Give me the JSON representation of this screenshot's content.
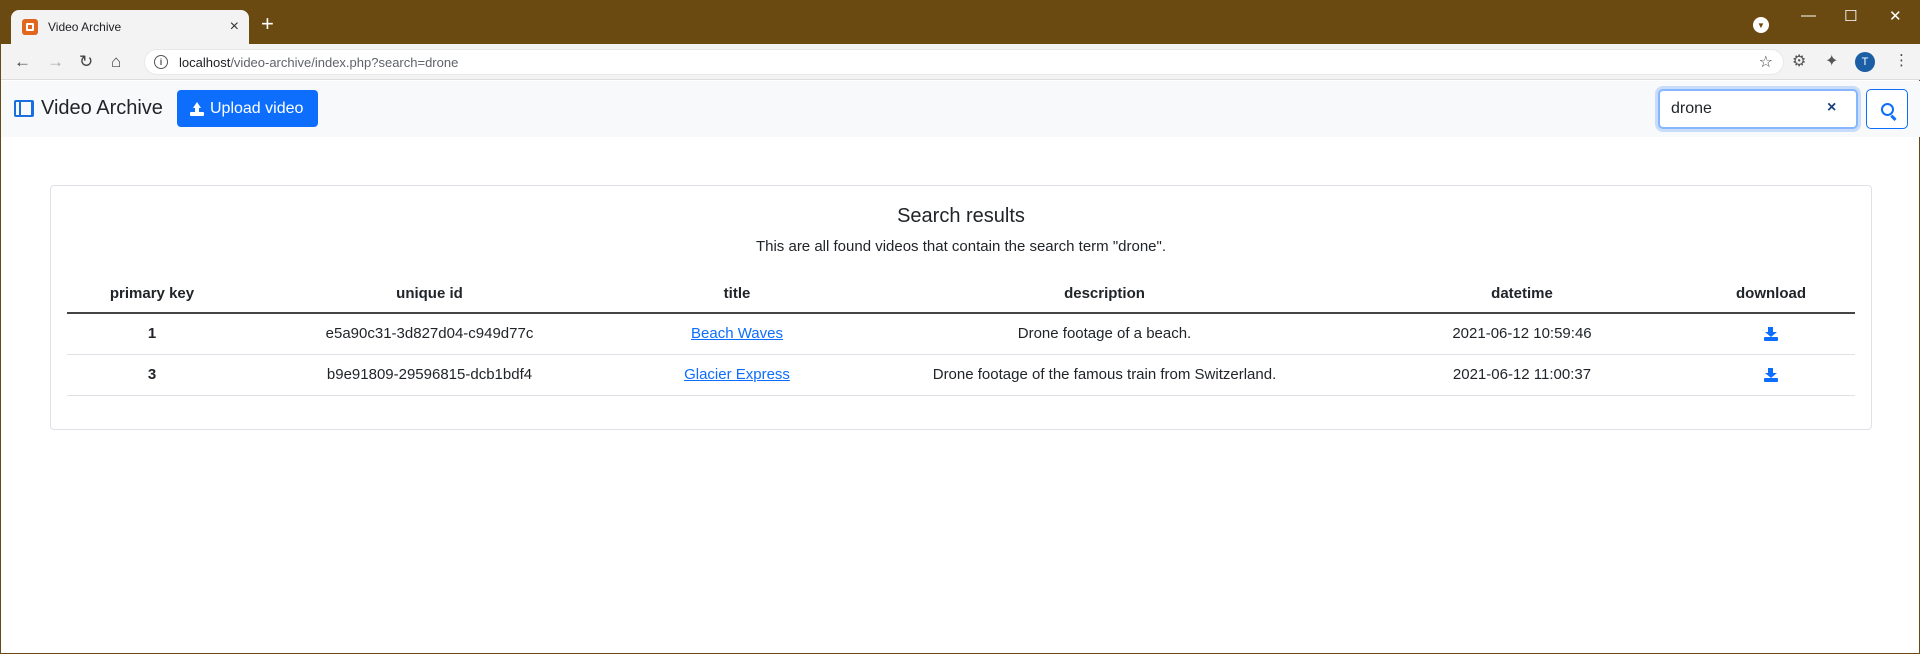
{
  "browser": {
    "tab_title": "Video Archive",
    "tab_close": "×",
    "new_tab": "+",
    "url_host": "localhost",
    "url_path": "/video-archive/index.php?search=drone",
    "avatar_letter": "T"
  },
  "navbar": {
    "brand": "Video Archive",
    "upload_label": "Upload video",
    "search_value": "drone",
    "clear_symbol": "×"
  },
  "results": {
    "title": "Search results",
    "subtitle": "This are all found videos that contain the search term \"drone\".",
    "columns": [
      "primary key",
      "unique id",
      "title",
      "description",
      "datetime",
      "download"
    ],
    "rows": [
      {
        "primary_key": "1",
        "unique_id": "e5a90c31-3d827d04-c949d77c",
        "title": "Beach Waves",
        "description": "Drone footage of a beach.",
        "datetime": "2021-06-12 10:59:46"
      },
      {
        "primary_key": "3",
        "unique_id": "b9e91809-29596815-dcb1bdf4",
        "title": "Glacier Express",
        "description": "Drone footage of the famous train from Switzerland.",
        "datetime": "2021-06-12 11:00:37"
      }
    ]
  },
  "colors": {
    "primary": "#0d6efd",
    "chrome": "#6b4a12",
    "navbar_bg": "#f8f9fa"
  },
  "icons": {
    "brand": "film-icon",
    "upload": "upload-icon",
    "search": "search-icon",
    "download": "download-icon"
  }
}
